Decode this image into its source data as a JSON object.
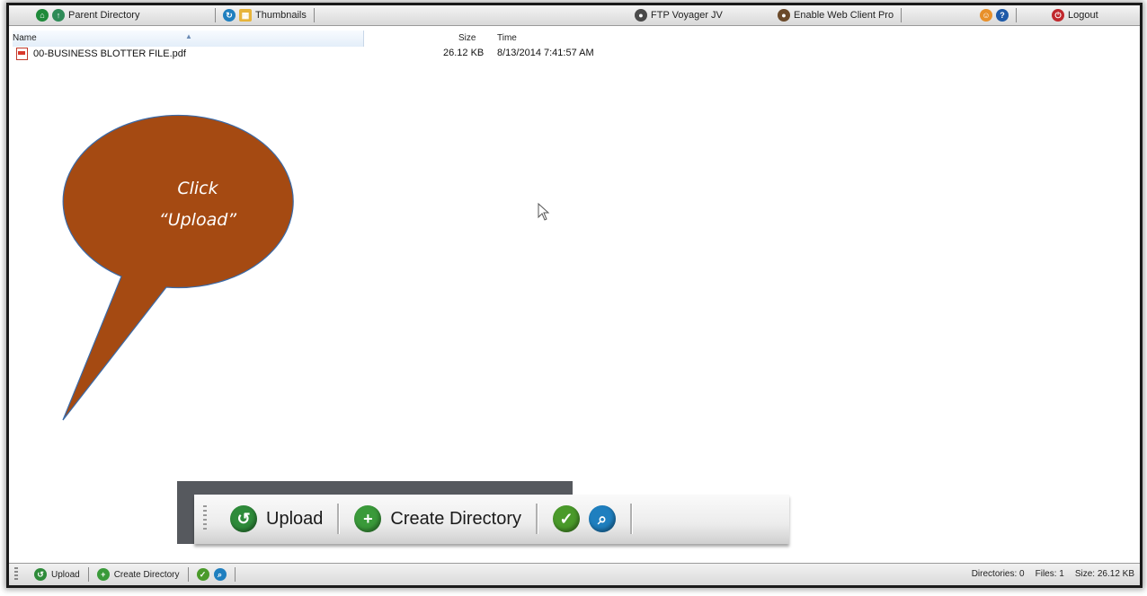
{
  "toolbar": {
    "parent_directory_label": "Parent Directory",
    "thumbnails_label": "Thumbnails",
    "ftp_voyager_label": "FTP Voyager JV",
    "enable_web_client_label": "Enable Web Client Pro",
    "logout_label": "Logout"
  },
  "columns": {
    "name": "Name",
    "size": "Size",
    "time": "Time"
  },
  "files": [
    {
      "name": "00-BUSINESS BLOTTER FILE.pdf",
      "size": "26.12 KB",
      "time": "8/13/2014 7:41:57 AM"
    }
  ],
  "callout": {
    "line1": "Click",
    "line2": "“Upload”",
    "fill_color": "#a54a12"
  },
  "bottom_toolbar": {
    "upload_label": "Upload",
    "create_directory_label": "Create Directory"
  },
  "status": {
    "directories": "Directories: 0",
    "files": "Files: 1",
    "size": "Size: 26.12 KB"
  },
  "zoom_toolbar": {
    "upload_label": "Upload",
    "create_directory_label": "Create Directory"
  }
}
